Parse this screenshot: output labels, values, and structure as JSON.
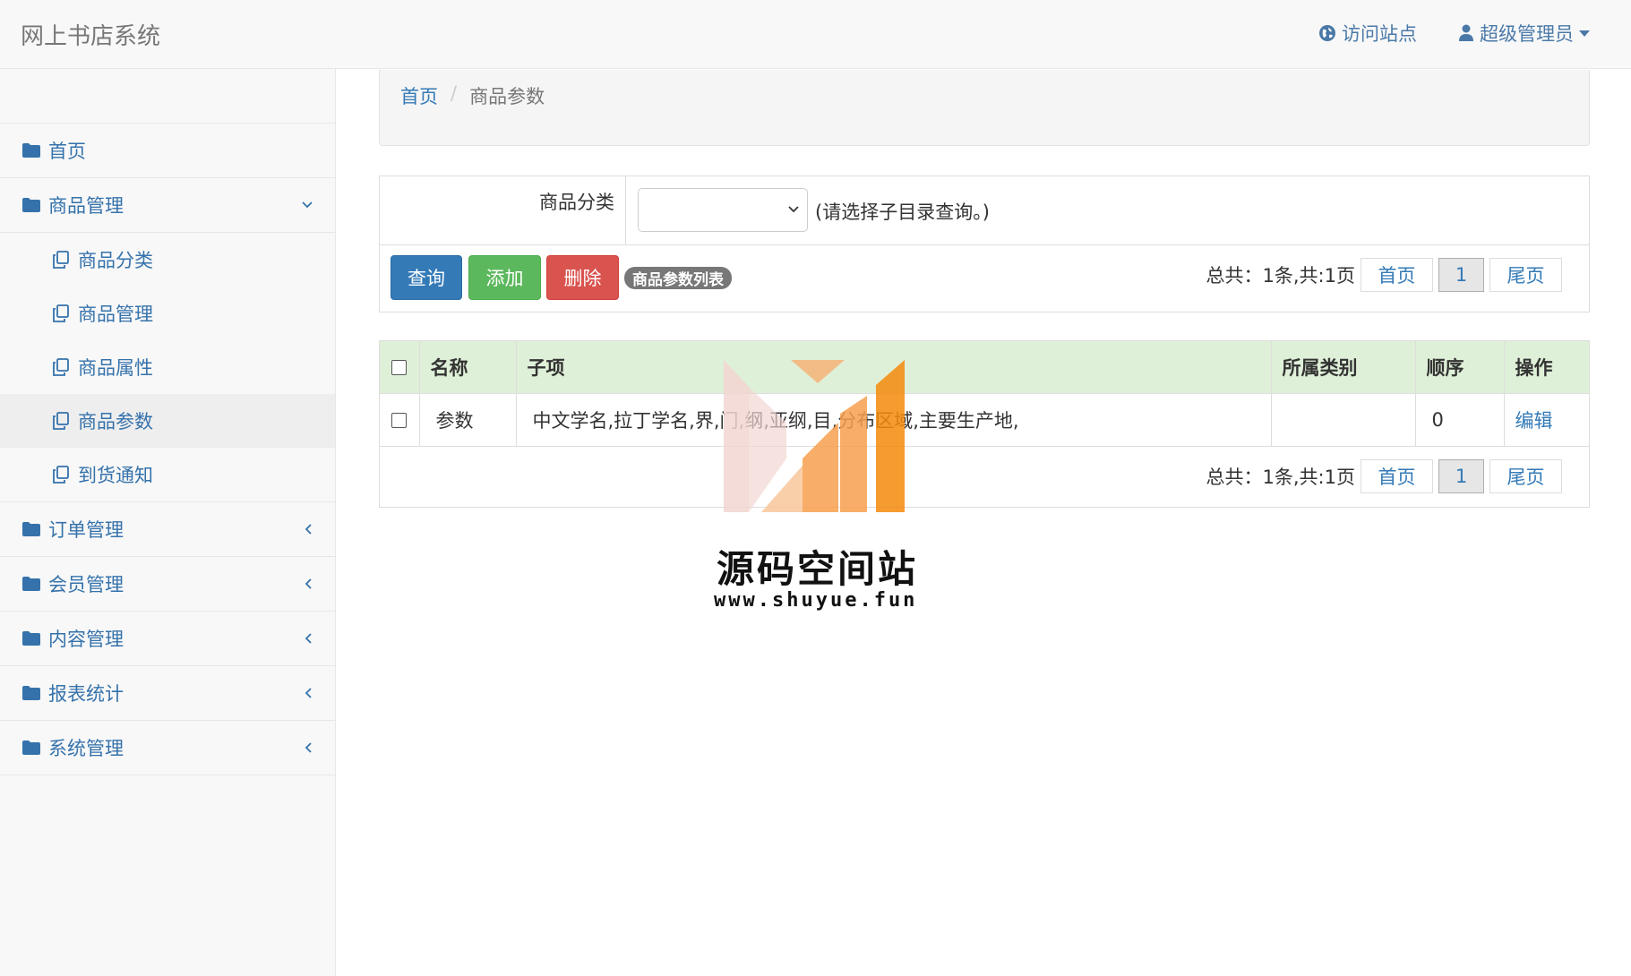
{
  "header": {
    "brand": "网上书店系统",
    "visit_site": "访问站点",
    "admin_user": "超级管理员"
  },
  "sidebar": {
    "items": [
      {
        "label": "首页"
      },
      {
        "label": "商品管理",
        "sub": [
          "商品分类",
          "商品管理",
          "商品属性",
          "商品参数",
          "到货通知"
        ]
      },
      {
        "label": "订单管理"
      },
      {
        "label": "会员管理"
      },
      {
        "label": "内容管理"
      },
      {
        "label": "报表统计"
      },
      {
        "label": "系统管理"
      }
    ],
    "active_sub": "商品参数"
  },
  "breadcrumb": {
    "home": "首页",
    "current": "商品参数"
  },
  "query": {
    "category_label": "商品分类",
    "category_value": "",
    "hint": "(请选择子目录查询。)",
    "buttons": {
      "query": "查询",
      "add": "添加",
      "delete": "删除"
    },
    "list_badge": "商品参数列表"
  },
  "pagination": {
    "total": "总共：1条,共:1页",
    "first": "首页",
    "current": "1",
    "last": "尾页"
  },
  "table": {
    "headers": [
      "名称",
      "子项",
      "所属类别",
      "顺序",
      "操作"
    ],
    "rows": [
      {
        "name": "参数",
        "items": "中文学名,拉丁学名,界,门,纲,亚纲,目,分布区域,主要生产地,",
        "category": "",
        "order": "0",
        "action": "编辑"
      }
    ]
  },
  "watermark": {
    "title": "源码空间站",
    "url": "www.shuyue.fun"
  },
  "colors": {
    "primary": "#337ab7",
    "success": "#5cb85c",
    "danger": "#d9534f",
    "table_header": "#dff0d8",
    "sidebar_text": "#3572ab"
  }
}
